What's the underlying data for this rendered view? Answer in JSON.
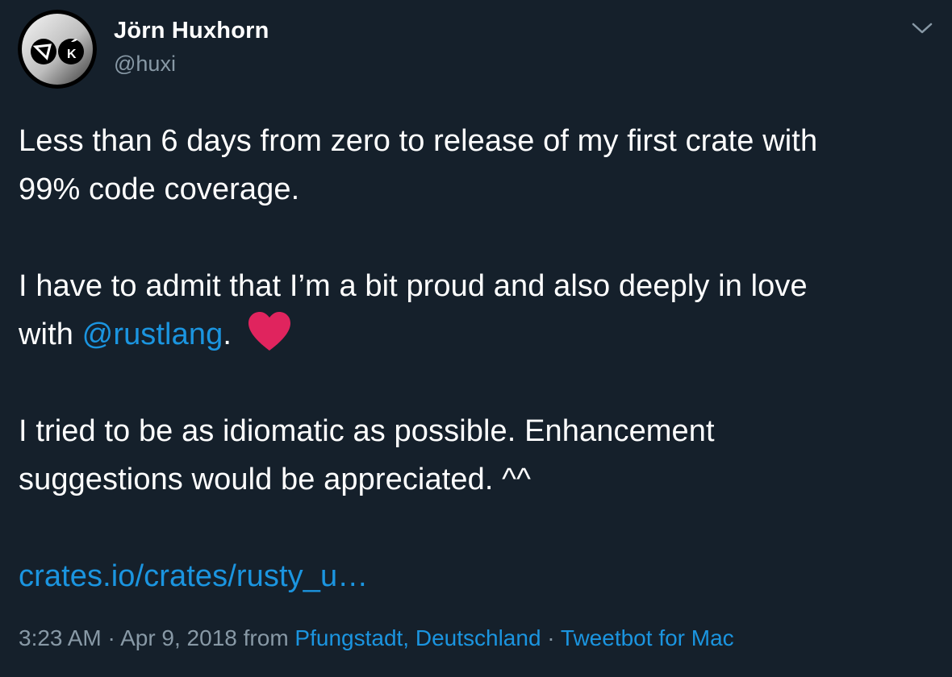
{
  "author": {
    "name": "Jörn Huxhorn",
    "handle": "@huxi",
    "avatar_icon": "wacom-apple-k-logo-icon"
  },
  "menu": {
    "icon": "chevron-down-icon"
  },
  "tweet": {
    "line1": "Less than 6 days from zero to release of my first crate with",
    "line2": "99% code coverage.",
    "line3": "I have to admit that I’m a bit proud and also deeply in love",
    "line4_prefix": "with ",
    "mention": "@rustlang",
    "line4_suffix": ".",
    "emoji": "red-heart-icon",
    "line5": "I tried to be as idiomatic as possible. Enhancement",
    "line6": "suggestions would be appreciated. ^^",
    "link_text": "crates.io/crates/rusty_u…"
  },
  "meta": {
    "time": "3:23 AM",
    "sep1": " · ",
    "date": "Apr 9, 2018",
    "from_text": " from ",
    "location": "Pfungstadt, Deutschland",
    "sep2": " · ",
    "client": "Tweetbot for Mac"
  },
  "colors": {
    "background": "#15202b",
    "text": "#ffffff",
    "secondary": "#8899a6",
    "link": "#1b95e0",
    "heart": "#e0245e"
  }
}
